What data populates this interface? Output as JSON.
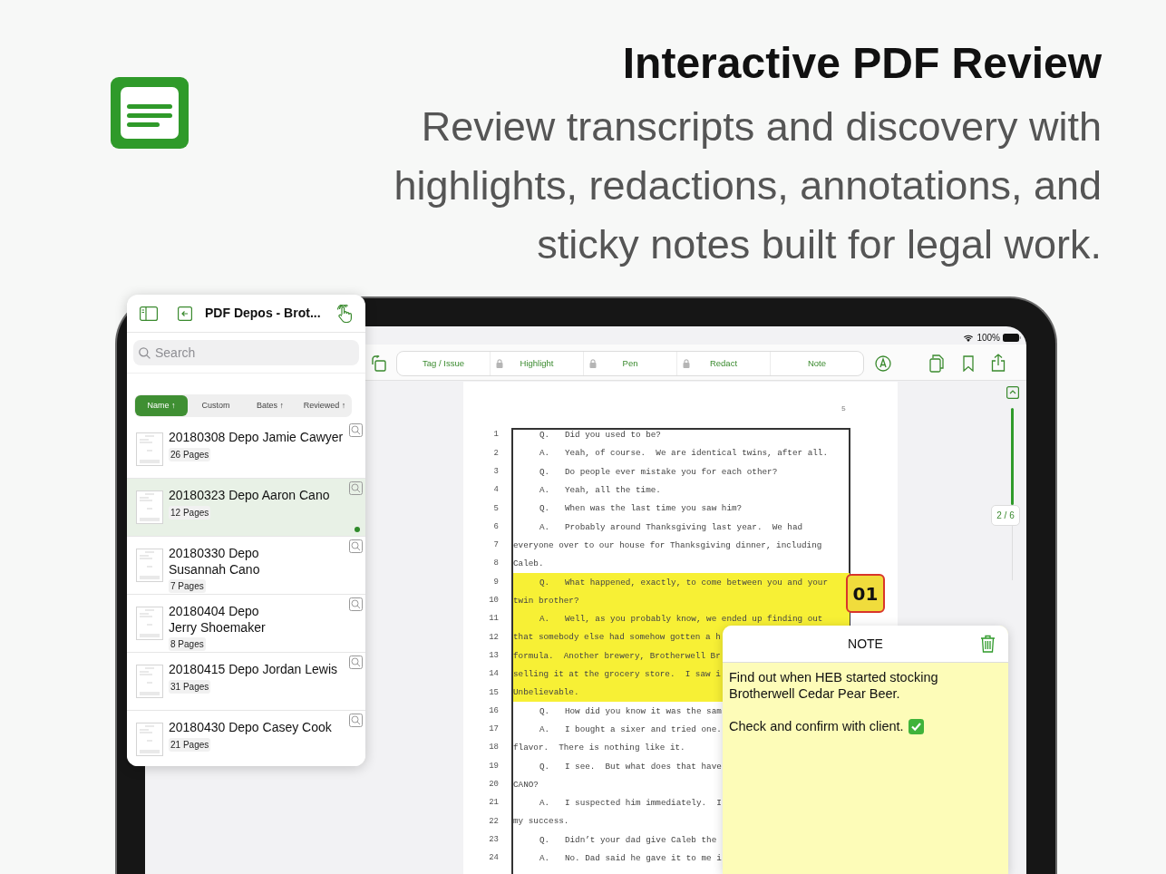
{
  "headline": {
    "title": "Interactive PDF Review",
    "subtitle_lines": [
      "Review transcripts and discovery with",
      "highlights, redactions, annotations, and",
      "sticky notes built for legal work."
    ]
  },
  "status_bar": {
    "battery": "100%"
  },
  "toolbar": {
    "tools": [
      {
        "label": "Tag / Issue",
        "locked": false
      },
      {
        "label": "Highlight",
        "locked": true
      },
      {
        "label": "Pen",
        "locked": true
      },
      {
        "label": "Redact",
        "locked": true
      },
      {
        "label": "Note",
        "locked": false
      }
    ]
  },
  "sidebar": {
    "title": "PDF Depos - Brot...",
    "search": {
      "placeholder": "Search"
    },
    "sort_options": [
      {
        "label": "Name ↑",
        "selected": true
      },
      {
        "label": "Custom",
        "selected": false
      },
      {
        "label": "Bates ↑",
        "selected": false
      },
      {
        "label": "Reviewed ↑",
        "selected": false
      }
    ],
    "files": [
      {
        "name": "20180308 Depo Jamie Cawyer",
        "pages": "26 Pages",
        "selected": false,
        "unread": false
      },
      {
        "name": "20180323 Depo Aaron Cano",
        "pages": "12 Pages",
        "selected": true,
        "unread": true
      },
      {
        "name": "20180330 Depo\nSusannah Cano",
        "pages": "7 Pages",
        "selected": false,
        "unread": false
      },
      {
        "name": "20180404 Depo\nJerry Shoemaker",
        "pages": "8 Pages",
        "selected": false,
        "unread": false
      },
      {
        "name": "20180415 Depo Jordan Lewis",
        "pages": "31 Pages",
        "selected": false,
        "unread": false
      },
      {
        "name": "20180430 Depo Casey Cook",
        "pages": "21 Pages",
        "selected": false,
        "unread": false
      }
    ]
  },
  "document": {
    "page_number": "5",
    "page_indicator": "2 / 6",
    "lines": [
      {
        "number": "1",
        "speaker": "Q.",
        "text": "Did you used to be?",
        "highlighted": false
      },
      {
        "number": "2",
        "speaker": "A.",
        "text": "Yeah, of course.  We are identical twins, after all.",
        "highlighted": false
      },
      {
        "number": "3",
        "speaker": "Q.",
        "text": "Do people ever mistake you for each other?",
        "highlighted": false
      },
      {
        "number": "4",
        "speaker": "A.",
        "text": "Yeah, all the time.",
        "highlighted": false
      },
      {
        "number": "5",
        "speaker": "Q.",
        "text": "When was the last time you saw him?",
        "highlighted": false
      },
      {
        "number": "6",
        "speaker": "A.",
        "text": "Probably around Thanksgiving last year.  We had",
        "highlighted": false
      },
      {
        "number": "7",
        "text": "everyone over to our house for Thanksgiving dinner, including",
        "highlighted": false
      },
      {
        "number": "8",
        "text": "Caleb.",
        "highlighted": false
      },
      {
        "number": "9",
        "speaker": "Q.",
        "text": "What happened, exactly, to come between you and your",
        "highlighted": true
      },
      {
        "number": "10",
        "text": "twin brother?",
        "highlighted": true
      },
      {
        "number": "11",
        "speaker": "A.",
        "text": "Well, as you probably know, we ended up finding out",
        "highlighted": true
      },
      {
        "number": "12",
        "text": "that somebody else had somehow gotten a h",
        "highlighted": true
      },
      {
        "number": "13",
        "text": "formula.  Another brewery, Brotherwell Br",
        "highlighted": true
      },
      {
        "number": "14",
        "text": "selling it at the grocery store.  I saw i",
        "highlighted": true
      },
      {
        "number": "15",
        "text": "Unbelievable.",
        "highlighted": true
      },
      {
        "number": "16",
        "speaker": "Q.",
        "text": "How did you know it was the sam",
        "highlighted": false
      },
      {
        "number": "17",
        "speaker": "A.",
        "text": "I bought a sixer and tried one.",
        "highlighted": false
      },
      {
        "number": "18",
        "text": "flavor.  There is nothing like it.",
        "highlighted": false
      },
      {
        "number": "19",
        "speaker": "Q.",
        "text": "I see.  But what does that have",
        "highlighted": false
      },
      {
        "number": "20",
        "text": "CANO?",
        "highlighted": false
      },
      {
        "number": "21",
        "speaker": "A.",
        "text": "I suspected him immediately.  I",
        "highlighted": false
      },
      {
        "number": "22",
        "text": "my success.",
        "highlighted": false
      },
      {
        "number": "23",
        "speaker": "Q.",
        "text": "Didn’t your dad give Caleb the",
        "highlighted": false
      },
      {
        "number": "24",
        "speaker": "A.",
        "text": "No. Dad said he gave it to me i",
        "highlighted": false
      }
    ]
  },
  "annotation": {
    "badge": "01",
    "note": {
      "title": "NOTE",
      "paragraphs": [
        "Find out when HEB started stocking Brotherwell Cedar Pear Beer.",
        "Check and confirm with client."
      ]
    }
  }
}
